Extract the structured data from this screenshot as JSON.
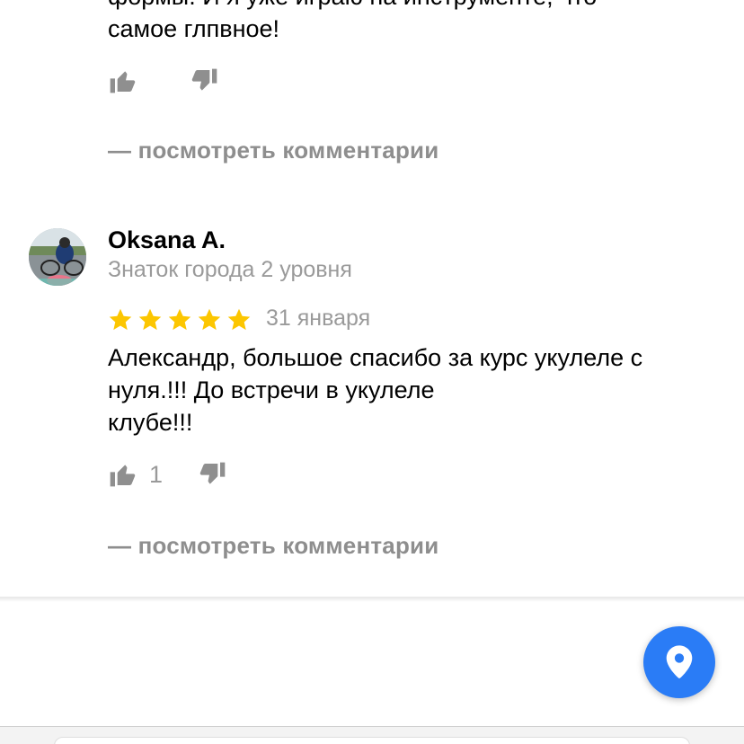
{
  "previous_review": {
    "text_line1": "формы. И я уже играю на инструменте, что",
    "text_line2": "самое глпвное!",
    "comments_link": "— посмотреть комментарии"
  },
  "review": {
    "author": "Oksana A.",
    "level": "Знаток города 2 уровня",
    "rating": 5,
    "date": "31 января",
    "text": "Александр, большое спасибо за курс укулеле с\nнуля.!!! До встречи в укулеле\nклубе!!!",
    "likes": "1",
    "comments_link": "— посмотреть комментарии"
  },
  "colors": {
    "star": "#fcc600",
    "fab": "#2a7cf6",
    "muted_text": "#9a9a9a"
  },
  "icons": {
    "like": "thumbs-up-icon",
    "dislike": "thumbs-down-icon",
    "star": "star-icon",
    "map_pin": "map-pin-icon"
  }
}
